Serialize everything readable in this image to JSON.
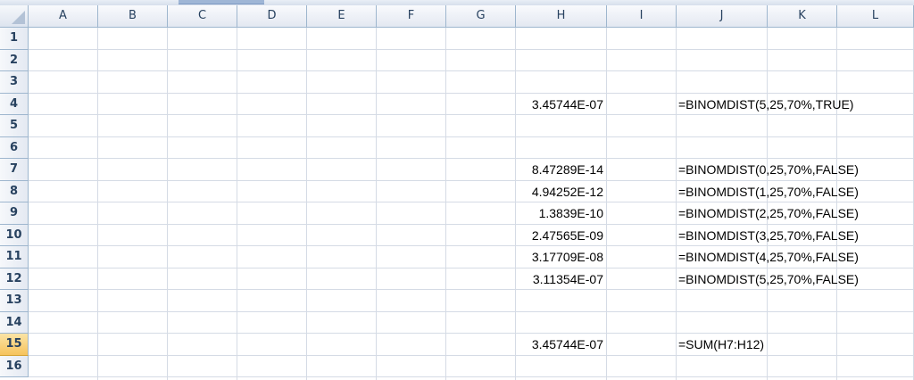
{
  "columns": [
    "A",
    "B",
    "C",
    "D",
    "E",
    "F",
    "G",
    "H",
    "I",
    "J",
    "K",
    "L"
  ],
  "rows": [
    "1",
    "2",
    "3",
    "4",
    "5",
    "6",
    "7",
    "8",
    "9",
    "10",
    "11",
    "12",
    "13",
    "14",
    "15",
    "16"
  ],
  "selected_row": "15",
  "cells": [
    {
      "ref": "H4",
      "value": "3.45744E-07"
    },
    {
      "ref": "J4",
      "value": "=BINOMDIST(5,25,70%,TRUE)"
    },
    {
      "ref": "H7",
      "value": "8.47289E-14"
    },
    {
      "ref": "J7",
      "value": "=BINOMDIST(0,25,70%,FALSE)"
    },
    {
      "ref": "H8",
      "value": "4.94252E-12"
    },
    {
      "ref": "J8",
      "value": "=BINOMDIST(1,25,70%,FALSE)"
    },
    {
      "ref": "H9",
      "value": "1.3839E-10"
    },
    {
      "ref": "J9",
      "value": "=BINOMDIST(2,25,70%,FALSE)"
    },
    {
      "ref": "H10",
      "value": "2.47565E-09"
    },
    {
      "ref": "J10",
      "value": "=BINOMDIST(3,25,70%,FALSE)"
    },
    {
      "ref": "H11",
      "value": "3.17709E-08"
    },
    {
      "ref": "J11",
      "value": "=BINOMDIST(4,25,70%,FALSE)"
    },
    {
      "ref": "H12",
      "value": "3.11354E-07"
    },
    {
      "ref": "J12",
      "value": "=BINOMDIST(5,25,70%,FALSE)"
    },
    {
      "ref": "H15",
      "value": "3.45744E-07"
    },
    {
      "ref": "J15",
      "value": "=SUM(H7:H12)"
    }
  ],
  "colors": {
    "header_border": "#9eb6ce",
    "gridline": "#d5dbe5",
    "selected_row_header": "#f6c35c"
  }
}
